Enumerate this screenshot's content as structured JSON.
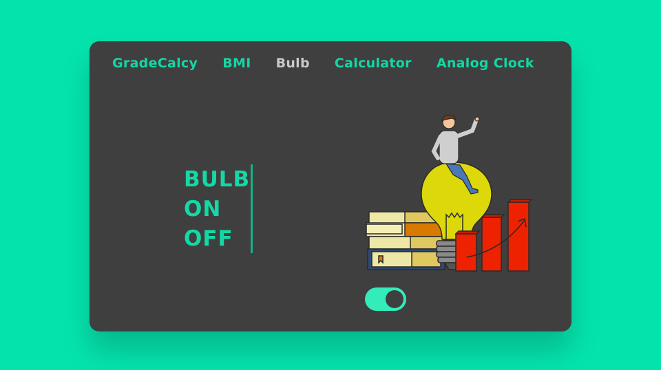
{
  "theme": {
    "page_background": "#05e3ad",
    "card_background": "#3f3f3f",
    "accent": "#16d6a3",
    "active_nav": "#c9c9c9",
    "toggle_color": "#33ecba"
  },
  "nav": {
    "items": [
      {
        "label": "GradeCalcy",
        "active": false
      },
      {
        "label": "BMI",
        "active": false
      },
      {
        "label": "Bulb",
        "active": true
      },
      {
        "label": "Calculator",
        "active": false
      },
      {
        "label": "Analog Clock",
        "active": false
      }
    ]
  },
  "main": {
    "lines": [
      "BULB",
      "ON",
      "OFF"
    ]
  },
  "toggle": {
    "state_on": true
  },
  "illustration": {
    "icons": [
      "person-icon",
      "lightbulb-icon",
      "books-icon",
      "bar-chart-icon",
      "trend-arrow-icon"
    ]
  }
}
